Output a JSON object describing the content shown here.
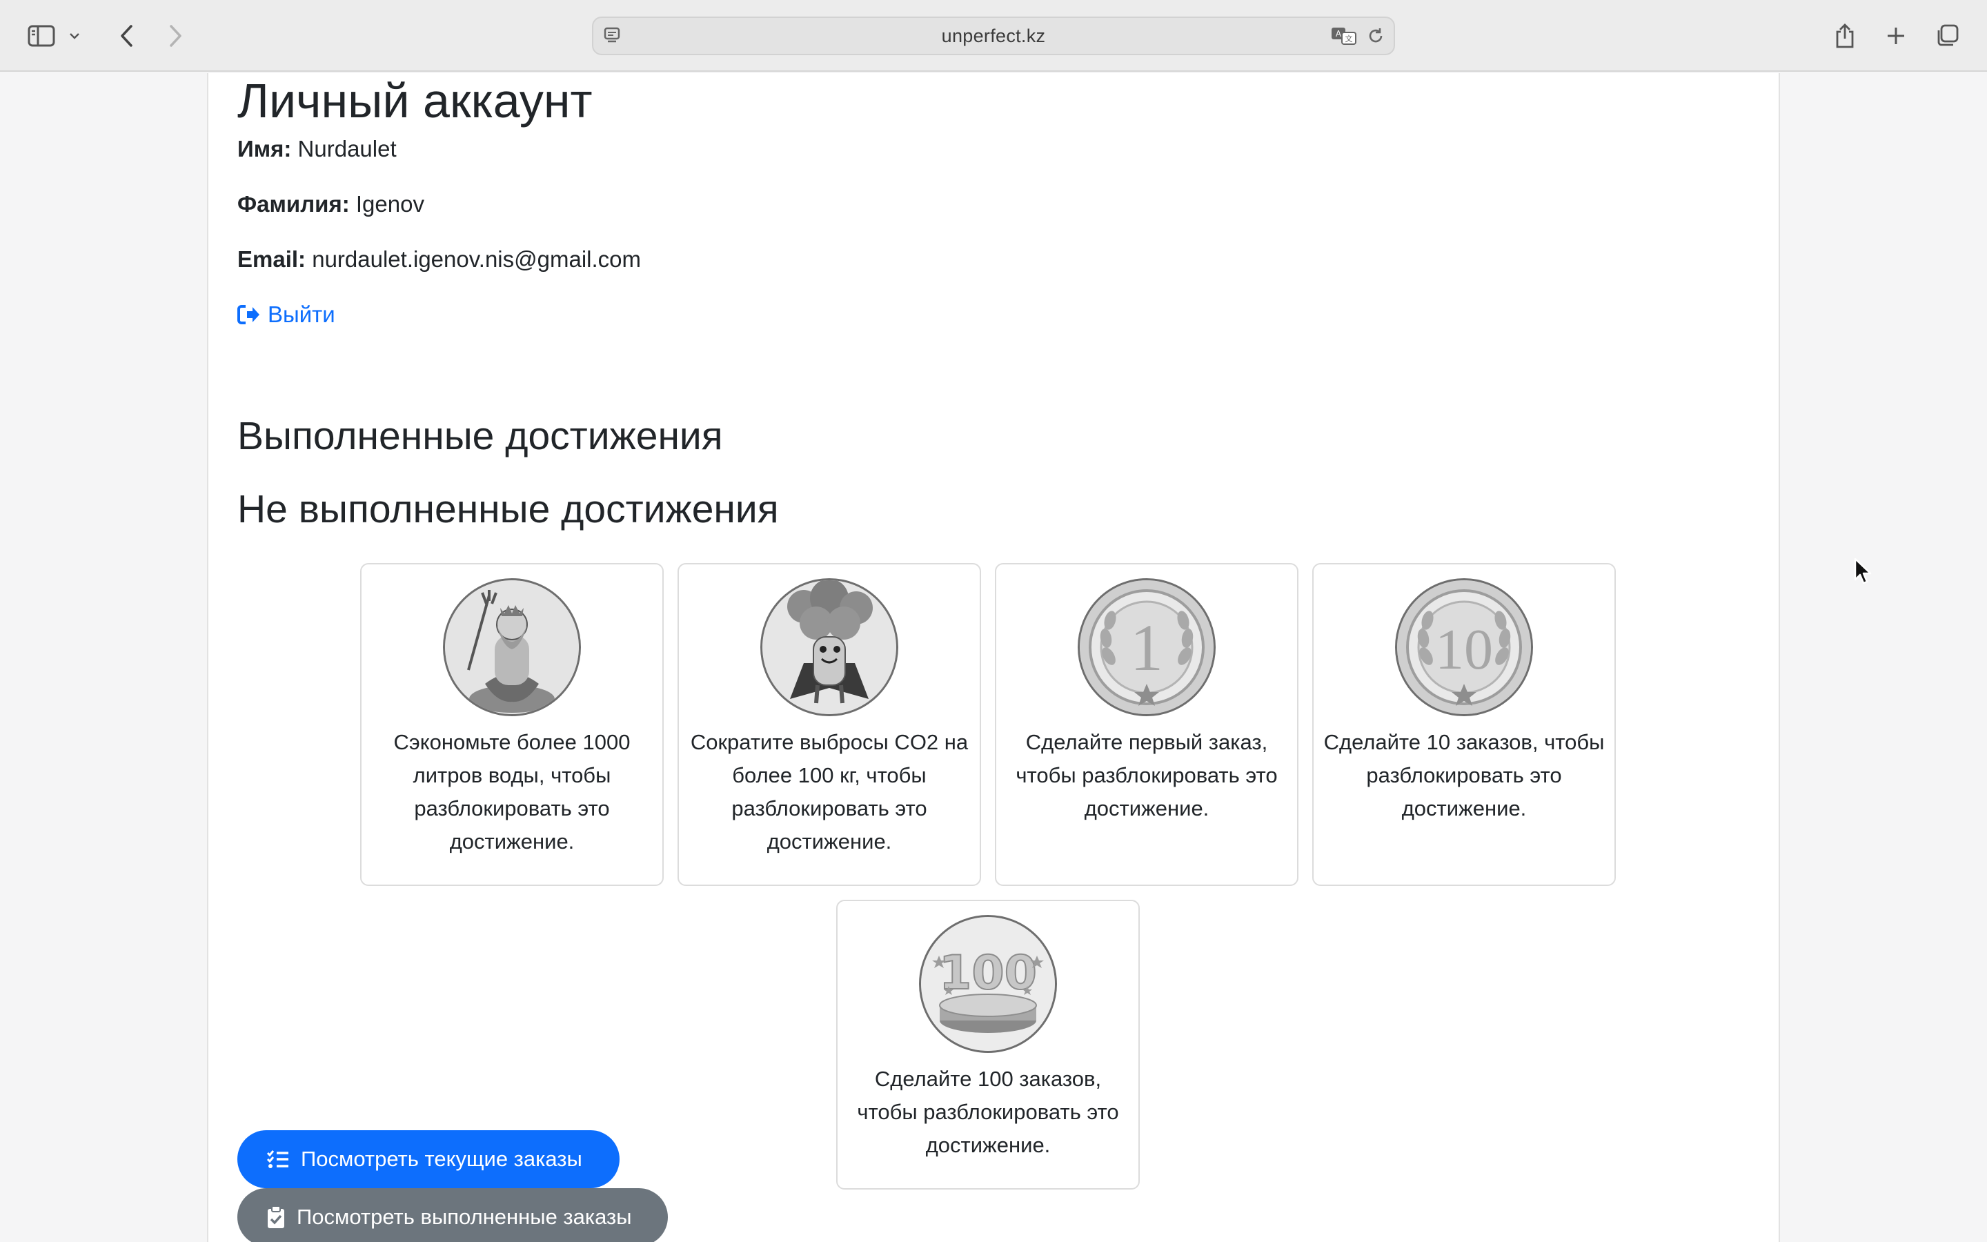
{
  "browser": {
    "url": "unperfect.kz",
    "icons": {
      "sidebar": "sidebar-icon",
      "tab_menu": "chevron-down-icon",
      "back": "chevron-left-icon",
      "forward": "chevron-right-icon",
      "site": "site-settings-icon",
      "translate": "translate-icon",
      "reload": "reload-icon",
      "share": "share-icon",
      "new_tab": "plus-icon",
      "tabs": "tabs-overview-icon"
    }
  },
  "account": {
    "title": "Личный аккаунт",
    "first_name_label": "Имя:",
    "first_name": "Nurdaulet",
    "last_name_label": "Фамилия:",
    "last_name": "Igenov",
    "email_label": "Email:",
    "email": "nurdaulet.igenov.nis@gmail.com",
    "logout_label": "Выйти"
  },
  "achievements": {
    "completed_title": "Выполненные достижения",
    "pending_title": "Не выполненные достижения",
    "pending": [
      {
        "icon": "poseidon-badge-icon",
        "text": "Сэкономьте более 1000 литров воды, чтобы разблокировать это достижение."
      },
      {
        "icon": "broccoli-hero-badge-icon",
        "text": "Сократите выбросы CO2 на более 100 кг, чтобы разблокировать это достижение."
      },
      {
        "icon": "coin-1-badge-icon",
        "text": "Сделайте первый заказ, чтобы разблокировать это достижение."
      },
      {
        "icon": "coin-10-badge-icon",
        "text": "Сделайте 10 заказов, чтобы разблокировать это достижение."
      },
      {
        "icon": "trophy-100-badge-icon",
        "text": "Сделайте 100 заказов, чтобы разблокировать это достижение."
      }
    ]
  },
  "actions": {
    "current_orders": "Посмотреть текущие заказы",
    "completed_orders": "Посмотреть выполненные заказы"
  },
  "colors": {
    "primary": "#0d6efd",
    "secondary": "#6c757d",
    "link": "#0d6efd"
  }
}
